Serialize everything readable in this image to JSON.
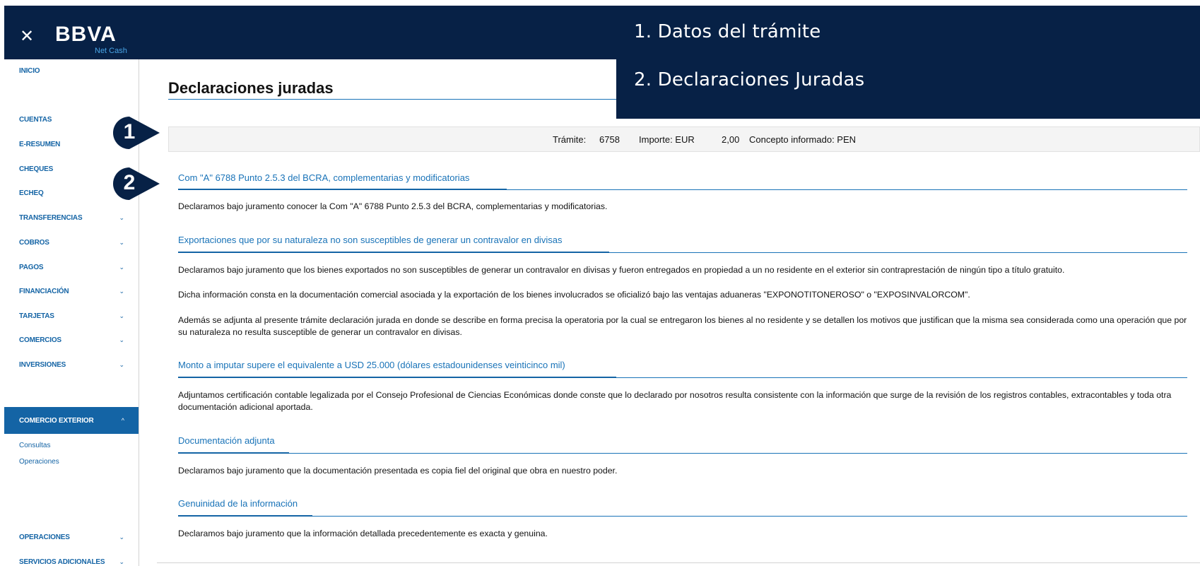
{
  "header": {
    "close_icon": "close-icon",
    "logo_text": "BBVA",
    "logo_sub": "Net Cash",
    "colors": {
      "bar": "#072146",
      "accent": "#1464a5",
      "link": "#1973b8"
    }
  },
  "sidebar": {
    "items": [
      {
        "label": "INICIO"
      },
      {
        "label": "CUENTAS"
      },
      {
        "label": "E-RESUMEN",
        "chevron": "⌄"
      },
      {
        "label": "CHEQUES"
      },
      {
        "label": "ECHEQ",
        "chevron": "⌄"
      },
      {
        "label": "TRANSFERENCIAS",
        "chevron": "⌄"
      },
      {
        "label": "COBROS",
        "chevron": "⌄"
      },
      {
        "label": "PAGOS",
        "chevron": "⌄"
      },
      {
        "label": "FINANCIACIÓN",
        "chevron": "⌄"
      },
      {
        "label": "TARJETAS",
        "chevron": "⌄"
      },
      {
        "label": "COMERCIOS",
        "chevron": "⌄"
      },
      {
        "label": "INVERSIONES",
        "chevron": "⌄"
      },
      {
        "label": "COMERCIO EXTERIOR",
        "chevron": "^"
      },
      {
        "label": "OPERACIONES",
        "chevron": "⌄"
      },
      {
        "label": "SERVICIOS ADICIONALES",
        "chevron": "⌄"
      }
    ],
    "subitems": [
      {
        "label": "Consultas"
      },
      {
        "label": "Operaciones"
      }
    ]
  },
  "main": {
    "title": "Declaraciones juradas",
    "info": {
      "tramite_label": "Trámite:",
      "tramite_value": "6758",
      "importe_label": "Importe: EUR",
      "importe_value": "2,00",
      "concepto": "Concepto informado: PEN"
    },
    "sections": [
      {
        "title": "Com \"A\" 6788 Punto 2.5.3 del BCRA, complementarias y modificatorias",
        "paragraphs": [
          "Declaramos bajo juramento conocer la Com \"A\" 6788 Punto 2.5.3 del BCRA, complementarias y modificatorias."
        ]
      },
      {
        "title": "Exportaciones que por su naturaleza no son susceptibles de generar un contravalor en divisas",
        "paragraphs": [
          "Declaramos bajo juramento que los bienes exportados no son susceptibles de generar un contravalor en divisas y fueron entregados en propiedad a un no residente en el exterior sin contraprestación de ningún tipo a título gratuito.",
          "Dicha información consta en la documentación comercial asociada y la exportación de los bienes involucrados se oficializó bajo las ventajas aduaneras \"EXPONOTITONEROSO\" o \"EXPOSINVALORCOM\".",
          "Además se adjunta al presente trámite declaración jurada en donde se describe en forma precisa la operatoria por la cual se entregaron los bienes al no residente y se detallen los motivos que justifican que la misma sea considerada como una operación que por su naturaleza no resulta susceptible de generar un contravalor en divisas."
        ]
      },
      {
        "title": "Monto a imputar supere el equivalente a USD 25.000 (dólares estadounidenses veinticinco mil)",
        "paragraphs": [
          "Adjuntamos certificación contable legalizada por el Consejo Profesional de Ciencias Económicas donde conste que lo declarado por nosotros resulta consistente con la información que surge de la revisión de los registros contables, extracontables y toda otra documentación adicional aportada."
        ]
      },
      {
        "title": "Documentación adjunta",
        "paragraphs": [
          "Declaramos bajo juramento que la documentación presentada es copia fiel del original que obra en nuestro poder."
        ]
      },
      {
        "title": "Genuinidad de la información",
        "paragraphs": [
          "Declaramos bajo juramento que la información detallada precedentemente es exacta y genuina."
        ]
      }
    ]
  },
  "callout": {
    "lines": [
      "1.   Datos del trámite",
      "2.   Declaraciones Juradas"
    ]
  },
  "badges": [
    "1",
    "2"
  ]
}
